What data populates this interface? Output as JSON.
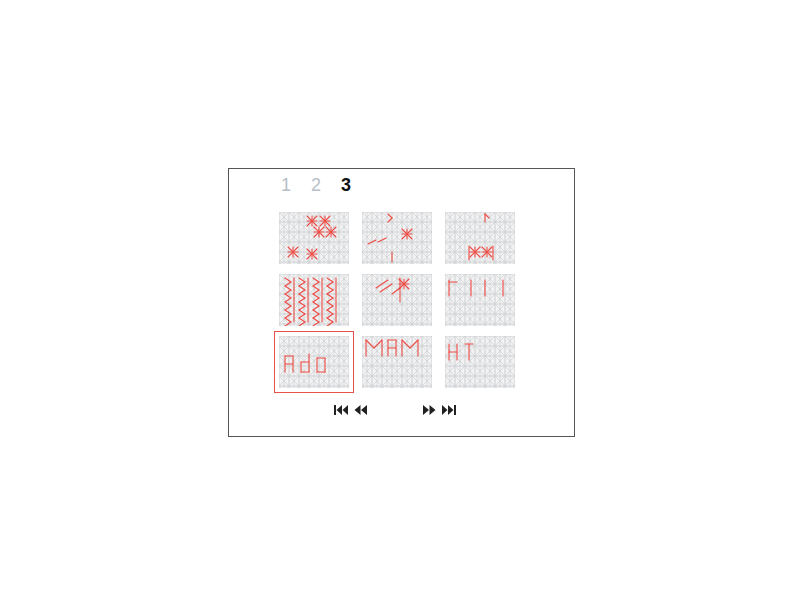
{
  "pages": [
    {
      "label": "1",
      "selected": false
    },
    {
      "label": "2",
      "selected": false
    },
    {
      "label": "3",
      "selected": true
    }
  ],
  "thumbnails": [
    {
      "selected": false
    },
    {
      "selected": false
    },
    {
      "selected": false
    },
    {
      "selected": false
    },
    {
      "selected": false
    },
    {
      "selected": false
    },
    {
      "selected": true
    },
    {
      "selected": false
    },
    {
      "selected": false
    }
  ],
  "navigation": [
    {
      "name": "first"
    },
    {
      "name": "previous"
    },
    {
      "name": "next"
    },
    {
      "name": "last"
    }
  ]
}
